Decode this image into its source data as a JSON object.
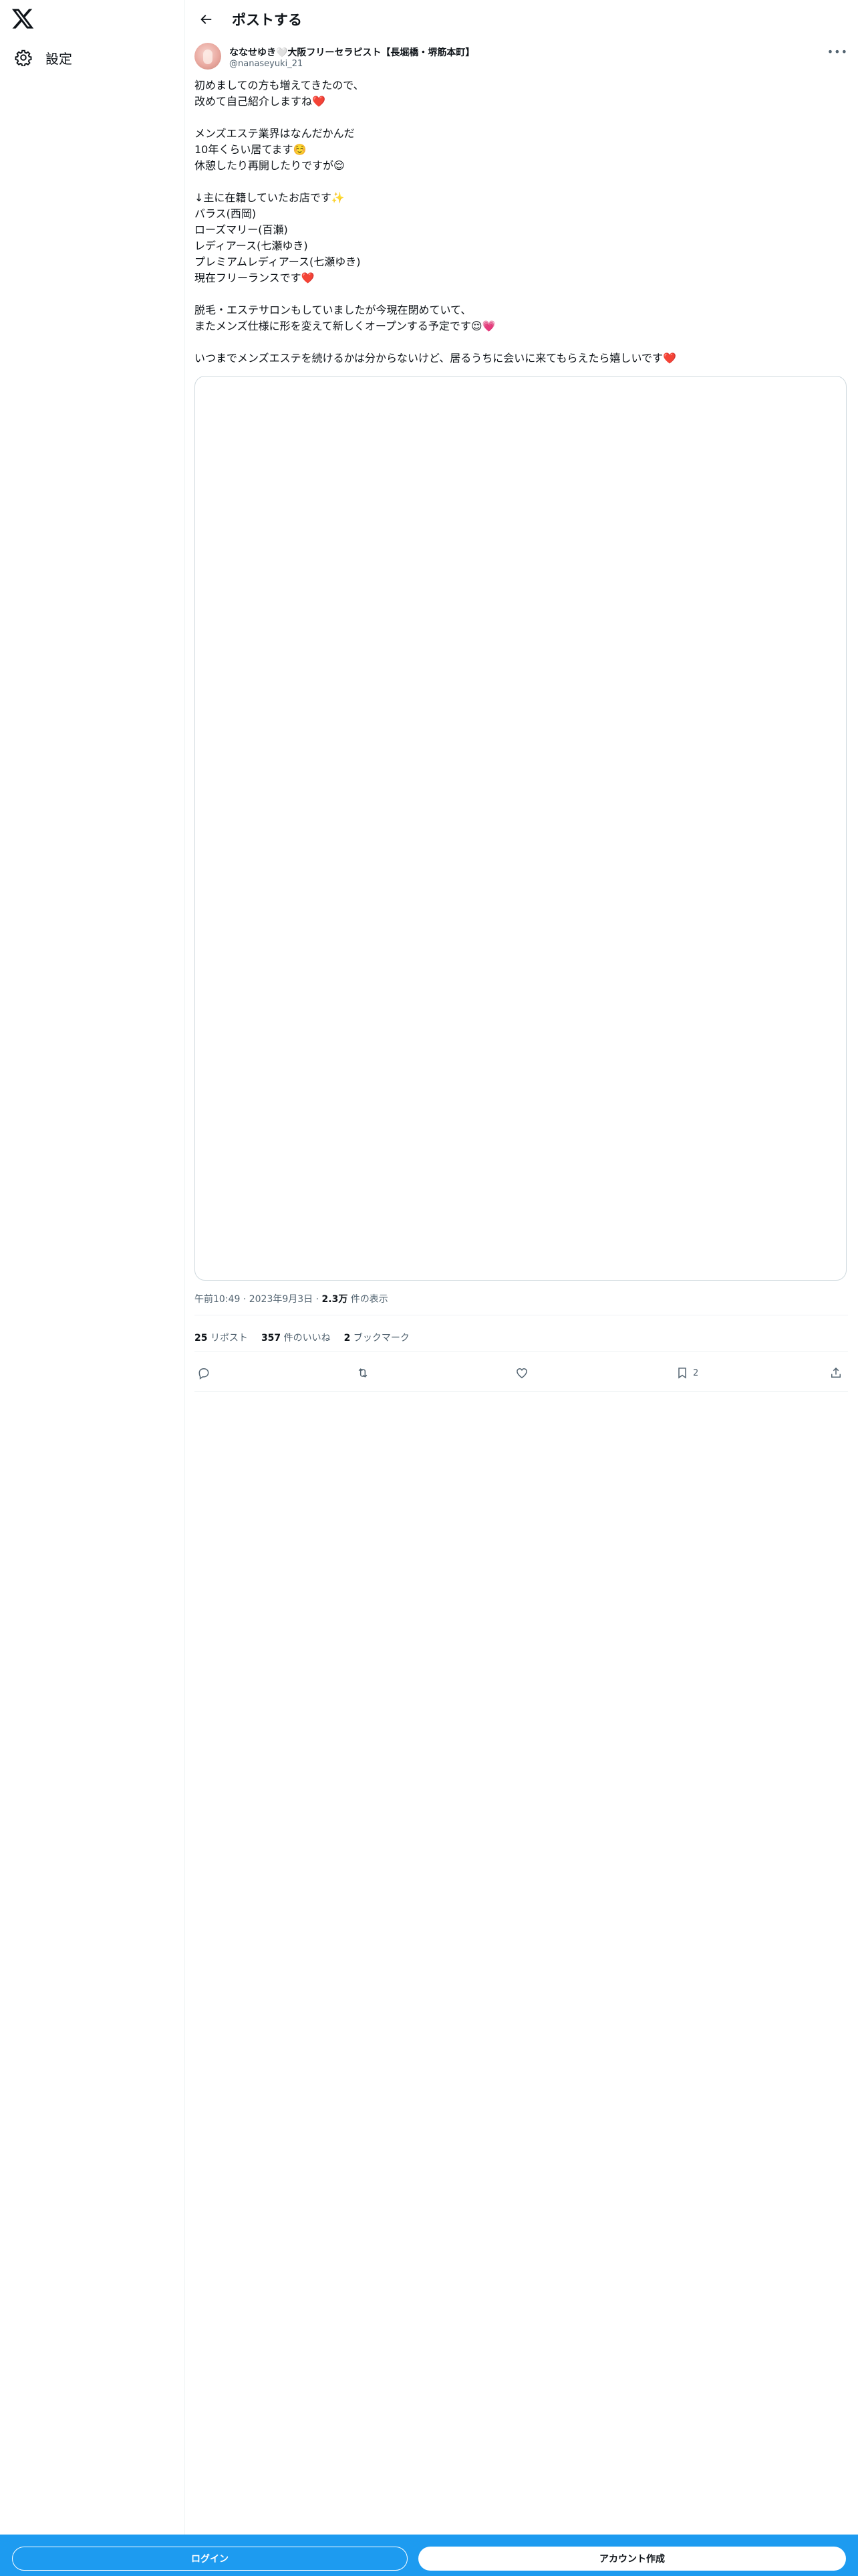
{
  "sidebar": {
    "settings_label": "設定"
  },
  "header": {
    "title": "ポストする"
  },
  "post": {
    "author_name": "ななせゆき🤍大阪フリーセラピスト【長堀橋・堺筋本町】",
    "author_handle": "@nanaseyuki_21",
    "lines": [
      "初めましての方も増えてきたので、",
      "改めて自己紹介しますね❤️",
      "",
      "メンズエステ業界はなんだかんだ",
      "10年くらい居てます☺️",
      "休憩したり再開したりですが😌",
      "",
      "↓主に在籍していたお店です✨",
      "バラス(西岡)",
      "ローズマリー(百瀬)",
      "レディアース(七瀬ゆき)",
      "プレミアムレディアース(七瀬ゆき)",
      "現在フリーランスです❤️",
      "",
      "脱毛・エステサロンもしていましたが今現在閉めていて、",
      "またメンズ仕様に形を変えて新しくオープンする予定です😌💗",
      "",
      "いつまでメンズエステを続けるかは分からないけど、居るうちに会いに来てもらえたら嬉しいです❤️"
    ],
    "time": "午前10:49",
    "date": "2023年9月3日",
    "views_count": "2.3万",
    "views_label": "件の表示",
    "reposts_count": "25",
    "reposts_label": "リポスト",
    "likes_count": "357",
    "likes_label": "件のいいね",
    "bookmarks_count": "2",
    "bookmarks_label": "ブックマーク",
    "bookmark_action_count": "2"
  },
  "bottom_bar": {
    "login_label": "ログイン",
    "signup_label": "アカウント作成"
  },
  "colors": {
    "accent": "#1d9bf0",
    "text": "#0f1419",
    "muted": "#536471",
    "border": "#eff3f4"
  },
  "icons": [
    "x-logo-icon",
    "gear-icon",
    "back-arrow-icon",
    "more-icon",
    "reply-icon",
    "repost-icon",
    "like-icon",
    "bookmark-icon",
    "share-icon"
  ]
}
